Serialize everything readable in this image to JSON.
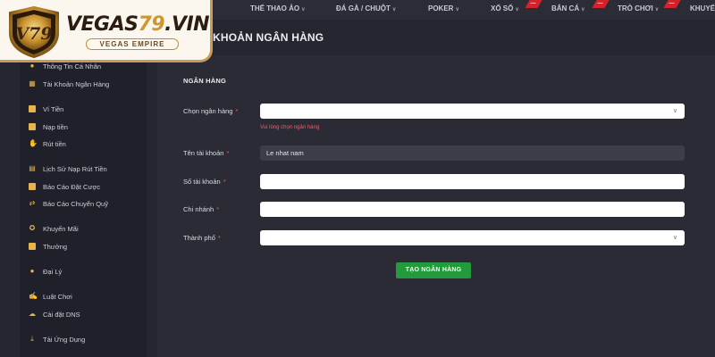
{
  "brand": {
    "name_text": "VEGAS",
    "name_number": "79",
    "name_suffix": ".VIN",
    "emblem_text": "V79",
    "tagline": "VEGAS EMPIRE"
  },
  "topnav": [
    {
      "label": "THỂ THAO ẢO",
      "chevron": true,
      "ribbon": false
    },
    {
      "label": "ĐÁ GÀ / CHUỘT",
      "chevron": true,
      "ribbon": false
    },
    {
      "label": "POKER",
      "chevron": true,
      "ribbon": false
    },
    {
      "label": "XỔ SỐ",
      "chevron": true,
      "ribbon": true
    },
    {
      "label": "BẮN CÁ",
      "chevron": true,
      "ribbon": true
    },
    {
      "label": "TRÒ CHƠI",
      "chevron": true,
      "ribbon": true
    },
    {
      "label": "KHUYẾN",
      "chevron": false,
      "ribbon": false
    }
  ],
  "page_title": "KHOẢN NGÂN HÀNG",
  "sidebar": [
    {
      "label": "Thông Tin Cá Nhân",
      "icon": "user-icon"
    },
    {
      "label": "Tài Khoản Ngân Hàng",
      "icon": "bank-icon"
    },
    {
      "label": "Ví Tiền",
      "icon": "wallet-icon"
    },
    {
      "label": "Nạp tiền",
      "icon": "deposit-icon"
    },
    {
      "label": "Rút tiền",
      "icon": "withdraw-icon"
    },
    {
      "label": "Lịch Sử Nạp Rút Tiền",
      "icon": "history-icon"
    },
    {
      "label": "Báo Cáo Đặt Cược",
      "icon": "bet-report-icon"
    },
    {
      "label": "Báo Cáo Chuyển Quỹ",
      "icon": "transfer-icon"
    },
    {
      "label": "Khuyến Mãi",
      "icon": "promotion-icon"
    },
    {
      "label": "Thưởng",
      "icon": "gift-icon"
    },
    {
      "label": "Đại Lý",
      "icon": "agent-icon"
    },
    {
      "label": "Luật Chơi",
      "icon": "rules-icon"
    },
    {
      "label": "Cài đặt DNS",
      "icon": "cloud-icon"
    },
    {
      "label": "Tải Ứng Dụng",
      "icon": "download-icon"
    }
  ],
  "form": {
    "section_label": "NGÂN HÀNG",
    "bank_label": "Chọn ngân hàng",
    "bank_value": "",
    "bank_error": "Vui lòng chọn ngân hàng",
    "account_name_label": "Tên tài khoản",
    "account_name_value": "Le nhat nam",
    "account_number_label": "Số tài khoản",
    "account_number_value": "",
    "branch_label": "Chi nhánh",
    "branch_value": "",
    "city_label": "Thành phố",
    "city_value": "",
    "required_mark": "*",
    "submit_label": "TẠO NGÂN HÀNG"
  },
  "colors": {
    "accent": "#239a3c",
    "error": "#ff5a5f",
    "icon": "#e8b44a",
    "brand_gold": "#cf962e"
  }
}
